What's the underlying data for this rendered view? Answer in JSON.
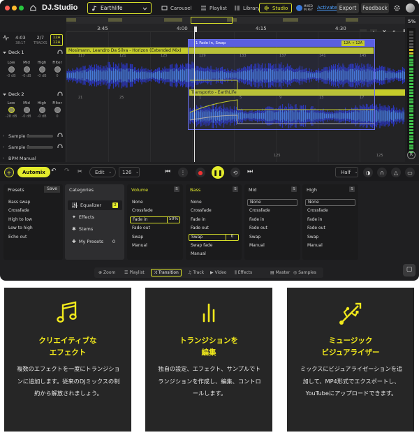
{
  "app": {
    "logo": "DJ.Studio",
    "project": "Earthlife"
  },
  "topnav": {
    "carousel": "Carousel",
    "playlist": "Playlist",
    "library": "Library",
    "studio": "Studio",
    "brand": "MIXED IN KEY",
    "activate": "Activate",
    "export": "Export",
    "feedback": "Feedback"
  },
  "timeline": {
    "marks": [
      "3:45",
      "4:00",
      "4:15",
      "4:30"
    ],
    "zoom": "5%"
  },
  "stats": {
    "time": "4:03",
    "time_label": "38:17",
    "tracks": "2/7",
    "tracks_label": "TRACKS",
    "key1": "12A",
    "key2": "12A"
  },
  "deck1": {
    "label": "Deck 1",
    "track": "Mosimann, Leandro Da Silva - Horizon (Extended Mix)",
    "knobs": [
      {
        "name": "Low",
        "value": "-0 dB"
      },
      {
        "name": "Mid",
        "value": "-0 dB"
      },
      {
        "name": "High",
        "value": "-0 dB"
      },
      {
        "name": "Filter",
        "value": "0"
      }
    ],
    "beats": [
      "117",
      "121",
      "125",
      "129",
      "133",
      "137",
      "141",
      "145"
    ]
  },
  "deck2": {
    "label": "Deck 2",
    "track": "Transporto - EarthLife",
    "knobs": [
      {
        "name": "Low",
        "value": "-28 dB"
      },
      {
        "name": "Mid",
        "value": "-0 dB"
      },
      {
        "name": "High",
        "value": "-0 dB"
      },
      {
        "name": "Filter",
        "value": "0"
      }
    ],
    "beats": [
      "21",
      "25",
      "1",
      "5",
      "9",
      "13",
      "17"
    ]
  },
  "transition": {
    "label": "1 Fade In, Swap",
    "key": "12A → 12A"
  },
  "rows": {
    "sample1": "Sample 1",
    "sample2": "Sample 2",
    "bpm": "BPM Manual",
    "beat_a": "125",
    "beat_b": "125"
  },
  "transport": {
    "automix": "Automix",
    "edit": "Edit",
    "bpm": "126",
    "half": "Half"
  },
  "presets": {
    "title": "Presets",
    "save": "Save",
    "items": [
      "Bass swap",
      "Crossfade",
      "High to low",
      "Low to high",
      "Echo out"
    ]
  },
  "categories": {
    "title": "Categories",
    "equalizer": "Equalizer",
    "equalizer_count": "2",
    "effects": "Effects",
    "stems": "Stems",
    "mypresets": "My Presets",
    "mypresets_count": "0"
  },
  "volume": {
    "title": "Volume",
    "badge": "S",
    "items": [
      "None",
      "Crossfade",
      "Fade in",
      "Fade out",
      "Swap",
      "Manual"
    ],
    "fade_in_pct": "50%"
  },
  "bass": {
    "title": "Bass",
    "badge": "S",
    "items": [
      "None",
      "Crossfade",
      "Fade in",
      "Fade out",
      "Swap",
      "Swap fade",
      "Manual"
    ],
    "swap_val": "0"
  },
  "mid": {
    "title": "Mid",
    "badge": "S",
    "items": [
      "None",
      "Crossfade",
      "Fade in",
      "Fade out",
      "Swap",
      "Manual"
    ]
  },
  "high": {
    "title": "High",
    "badge": "S",
    "items": [
      "None",
      "Crossfade",
      "Fade in",
      "Fade out",
      "Swap",
      "Manual"
    ]
  },
  "tabs": [
    "Zoom",
    "Playlist",
    "Transition",
    "Track",
    "Video",
    "Effects",
    "Master",
    "Samples"
  ],
  "cards": [
    {
      "title1": "クリエイティブな",
      "title2": "エフェクト",
      "body": "複数のエフェクトを一度にトランジションに追加します。従来のDJミックスの制約から解放されましょう。"
    },
    {
      "title1": "トランジションを",
      "title2": "編集",
      "body": "独自の設定、エフェクト、サンプルでトランジションを作成し、編集、コントロールします。"
    },
    {
      "title1": "ミュージック",
      "title2": "ビジュアライザー",
      "body": "ミックスにビジュアライゼーションを追加して、MP4形式でエクスポートし、YouTubeにアップロードできます。"
    }
  ],
  "colors": {
    "accent": "#d8e02a",
    "card_title": "#f2ea1c",
    "transition": "#6a6ff0"
  }
}
